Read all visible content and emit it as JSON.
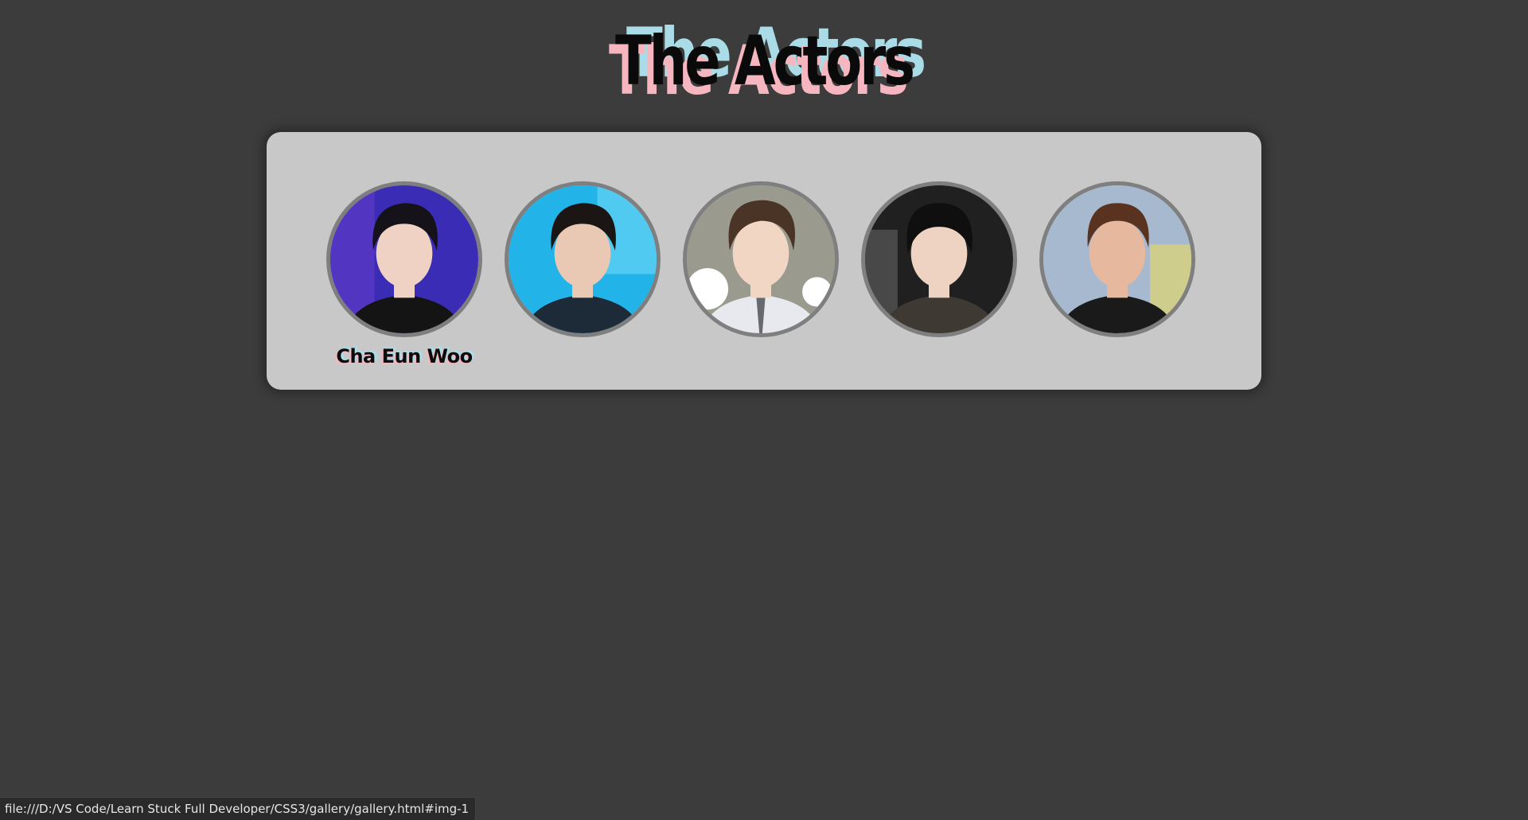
{
  "page": {
    "title": "The Actors"
  },
  "gallery": {
    "items": [
      {
        "caption": "Cha Eun Woo",
        "bg": "#3a2cb5",
        "hair": "#15121a",
        "skin": "#f0d2c4",
        "clothes": "#141414",
        "accent": "#6a3fd0"
      },
      {
        "caption": "",
        "bg": "#22b4e8",
        "hair": "#1b1614",
        "skin": "#e9c8b4",
        "clothes": "#1d2a38",
        "accent": "#6fd8f5"
      },
      {
        "caption": "",
        "bg": "#9a9a8e",
        "hair": "#4a3426",
        "skin": "#f1d6c4",
        "clothes": "#e8e9ee",
        "accent": "#ffffff"
      },
      {
        "caption": "",
        "bg": "#202020",
        "hair": "#0f0f10",
        "skin": "#eed2c2",
        "clothes": "#3e3a33",
        "accent": "#5a5a5a"
      },
      {
        "caption": "",
        "bg": "#a7b9cf",
        "hair": "#5a3320",
        "skin": "#e6b89e",
        "clothes": "#1a1a1a",
        "accent": "#d9d27a"
      }
    ]
  },
  "statusbar": {
    "url": "file:///D:/VS Code/Learn Stuck Full Developer/CSS3/gallery/gallery.html#img-1"
  }
}
